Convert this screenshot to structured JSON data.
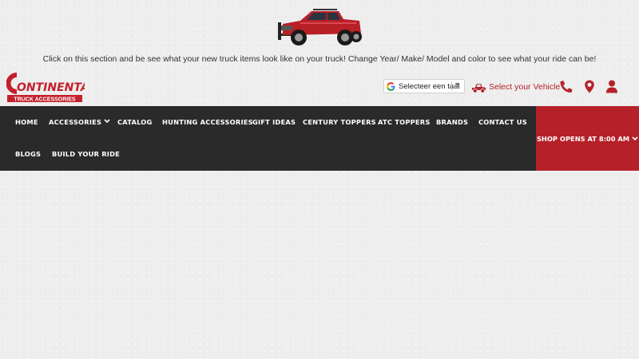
{
  "banner": {
    "text": "Click on this section and be see what your new truck items look like on your truck! Change Year/ Make/ Model and color to see what your ride can be!"
  },
  "logo": {
    "name": "ONTINENTAL",
    "initial": "C",
    "tagline": "TRUCK ACCESSORIES"
  },
  "translate": {
    "label": "Selecteer een taal",
    "arrow": "▼"
  },
  "vehicle": {
    "label": "Select your Vehicle"
  },
  "icons": {
    "phone": "phone-icon",
    "location": "map-marker-icon",
    "account": "user-icon",
    "vehicle": "truck-icon"
  },
  "nav": {
    "items": [
      {
        "label": "HOME",
        "dropdown": false
      },
      {
        "label": "ACCESSORIES",
        "dropdown": true
      },
      {
        "label": "CATALOG",
        "dropdown": false
      },
      {
        "label": "HUNTING ACCESSORIES",
        "dropdown": false
      },
      {
        "label": "GIFT IDEAS",
        "dropdown": false
      },
      {
        "label": "CENTURY TOPPERS",
        "dropdown": false
      },
      {
        "label": "ATC TOPPERS",
        "dropdown": false
      },
      {
        "label": "BRANDS",
        "dropdown": false
      },
      {
        "label": "CONTACT US",
        "dropdown": false
      },
      {
        "label": "BLOGS",
        "dropdown": false
      },
      {
        "label": "BUILD YOUR RIDE",
        "dropdown": false
      }
    ]
  },
  "hours": {
    "label": "SHOP OPENS AT 8:00 AM"
  },
  "colors": {
    "brand_red": "#b62129",
    "nav_bg": "#2a2a2a",
    "background": "#eeeeee"
  }
}
